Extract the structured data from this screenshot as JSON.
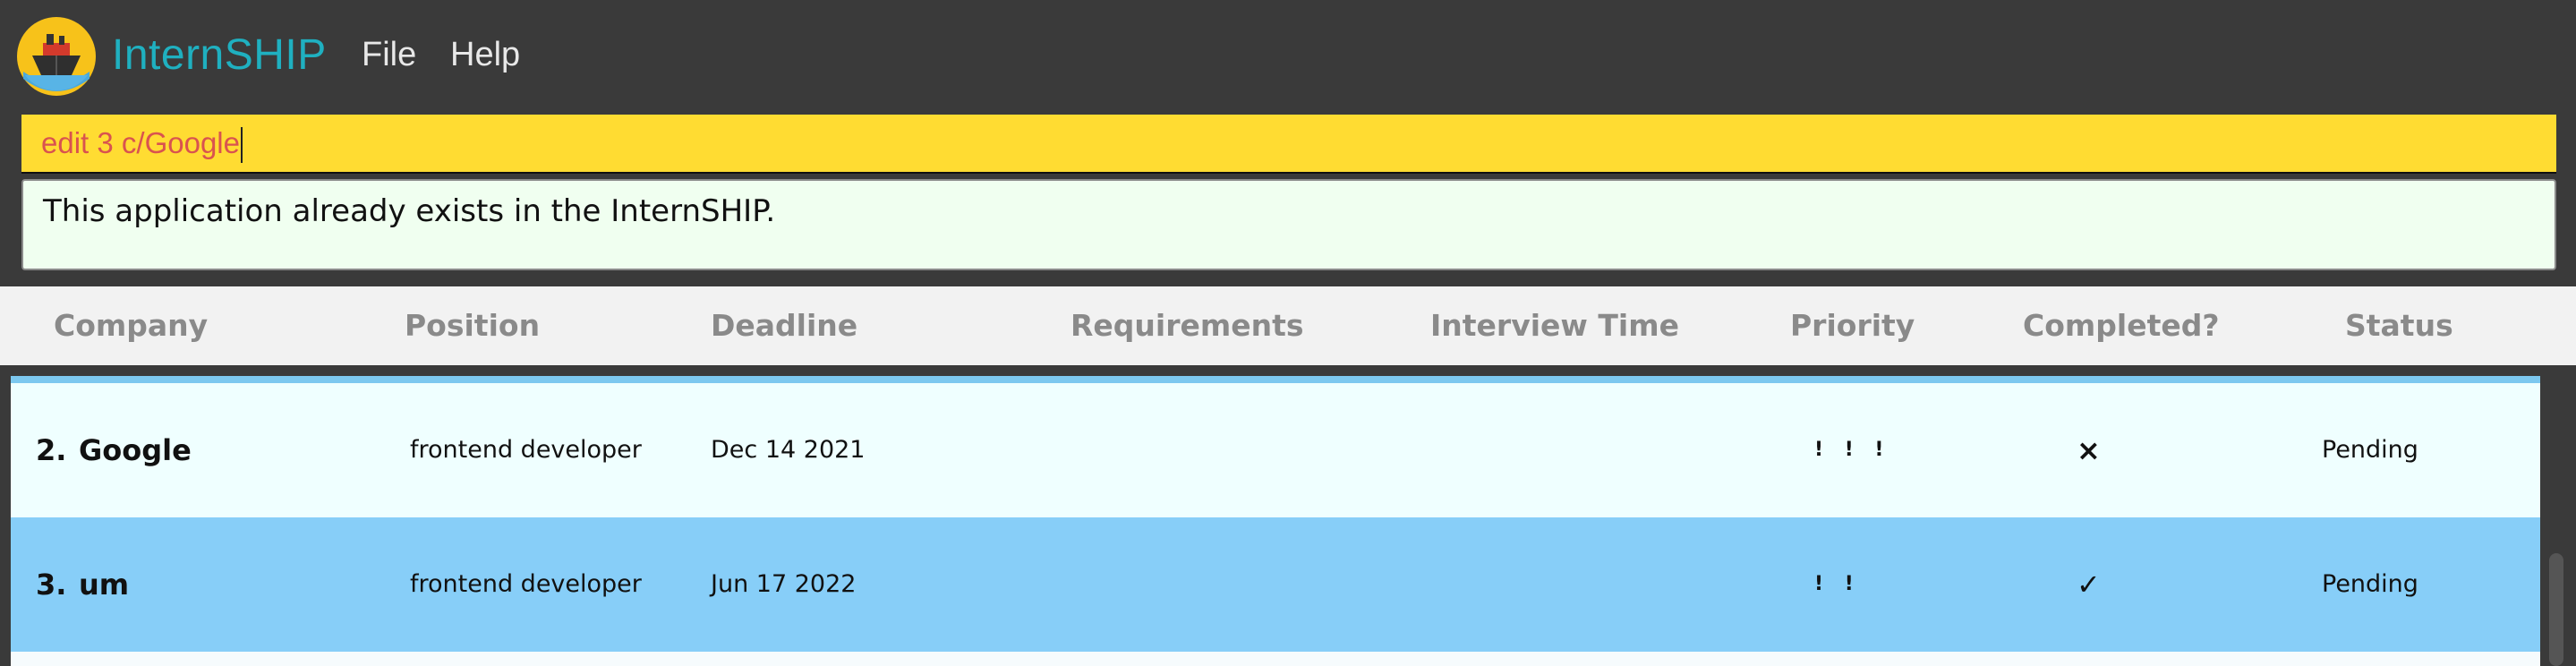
{
  "app": {
    "title": "InternSHIP",
    "logo_icon": "ship-logo-icon"
  },
  "menu": {
    "file_label": "File",
    "help_label": "Help"
  },
  "command": {
    "value": "edit 3 c/Google"
  },
  "result": {
    "message": "This application already exists in the InternSHIP."
  },
  "table": {
    "columns": [
      "Company",
      "Position",
      "Deadline",
      "Requirements",
      "Interview Time",
      "Priority",
      "Completed?",
      "Status"
    ],
    "rows": [
      {
        "index": "2.",
        "company": "Google",
        "position": "frontend developer",
        "deadline": "Dec 14 2021",
        "requirements": "",
        "interview_time": "",
        "priority": "! ! !",
        "completed": "×",
        "status": "Pending"
      },
      {
        "index": "3.",
        "company": "um",
        "position": "frontend developer",
        "deadline": "Jun 17 2022",
        "requirements": "",
        "interview_time": "",
        "priority": "! !",
        "completed": "✓",
        "status": "Pending"
      }
    ]
  },
  "colors": {
    "title": "#1fb0c0",
    "command_bg": "#ffdc32",
    "command_text": "#d9534f",
    "result_bg": "#f0fff0",
    "row_default": "#efffff",
    "row_selected": "#87cef8",
    "app_bg": "#3a3a3a"
  }
}
